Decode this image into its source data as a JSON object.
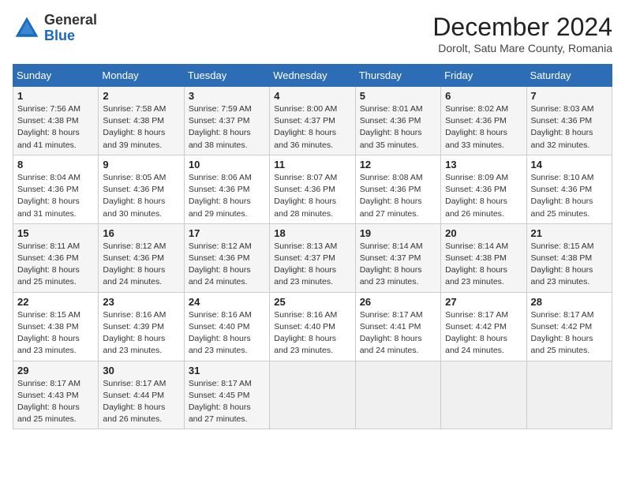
{
  "header": {
    "logo_general": "General",
    "logo_blue": "Blue",
    "month_title": "December 2024",
    "subtitle": "Dorolt, Satu Mare County, Romania"
  },
  "weekdays": [
    "Sunday",
    "Monday",
    "Tuesday",
    "Wednesday",
    "Thursday",
    "Friday",
    "Saturday"
  ],
  "weeks": [
    [
      {
        "day": "1",
        "sunrise": "Sunrise: 7:56 AM",
        "sunset": "Sunset: 4:38 PM",
        "daylight": "Daylight: 8 hours and 41 minutes."
      },
      {
        "day": "2",
        "sunrise": "Sunrise: 7:58 AM",
        "sunset": "Sunset: 4:38 PM",
        "daylight": "Daylight: 8 hours and 39 minutes."
      },
      {
        "day": "3",
        "sunrise": "Sunrise: 7:59 AM",
        "sunset": "Sunset: 4:37 PM",
        "daylight": "Daylight: 8 hours and 38 minutes."
      },
      {
        "day": "4",
        "sunrise": "Sunrise: 8:00 AM",
        "sunset": "Sunset: 4:37 PM",
        "daylight": "Daylight: 8 hours and 36 minutes."
      },
      {
        "day": "5",
        "sunrise": "Sunrise: 8:01 AM",
        "sunset": "Sunset: 4:36 PM",
        "daylight": "Daylight: 8 hours and 35 minutes."
      },
      {
        "day": "6",
        "sunrise": "Sunrise: 8:02 AM",
        "sunset": "Sunset: 4:36 PM",
        "daylight": "Daylight: 8 hours and 33 minutes."
      },
      {
        "day": "7",
        "sunrise": "Sunrise: 8:03 AM",
        "sunset": "Sunset: 4:36 PM",
        "daylight": "Daylight: 8 hours and 32 minutes."
      }
    ],
    [
      {
        "day": "8",
        "sunrise": "Sunrise: 8:04 AM",
        "sunset": "Sunset: 4:36 PM",
        "daylight": "Daylight: 8 hours and 31 minutes."
      },
      {
        "day": "9",
        "sunrise": "Sunrise: 8:05 AM",
        "sunset": "Sunset: 4:36 PM",
        "daylight": "Daylight: 8 hours and 30 minutes."
      },
      {
        "day": "10",
        "sunrise": "Sunrise: 8:06 AM",
        "sunset": "Sunset: 4:36 PM",
        "daylight": "Daylight: 8 hours and 29 minutes."
      },
      {
        "day": "11",
        "sunrise": "Sunrise: 8:07 AM",
        "sunset": "Sunset: 4:36 PM",
        "daylight": "Daylight: 8 hours and 28 minutes."
      },
      {
        "day": "12",
        "sunrise": "Sunrise: 8:08 AM",
        "sunset": "Sunset: 4:36 PM",
        "daylight": "Daylight: 8 hours and 27 minutes."
      },
      {
        "day": "13",
        "sunrise": "Sunrise: 8:09 AM",
        "sunset": "Sunset: 4:36 PM",
        "daylight": "Daylight: 8 hours and 26 minutes."
      },
      {
        "day": "14",
        "sunrise": "Sunrise: 8:10 AM",
        "sunset": "Sunset: 4:36 PM",
        "daylight": "Daylight: 8 hours and 25 minutes."
      }
    ],
    [
      {
        "day": "15",
        "sunrise": "Sunrise: 8:11 AM",
        "sunset": "Sunset: 4:36 PM",
        "daylight": "Daylight: 8 hours and 25 minutes."
      },
      {
        "day": "16",
        "sunrise": "Sunrise: 8:12 AM",
        "sunset": "Sunset: 4:36 PM",
        "daylight": "Daylight: 8 hours and 24 minutes."
      },
      {
        "day": "17",
        "sunrise": "Sunrise: 8:12 AM",
        "sunset": "Sunset: 4:36 PM",
        "daylight": "Daylight: 8 hours and 24 minutes."
      },
      {
        "day": "18",
        "sunrise": "Sunrise: 8:13 AM",
        "sunset": "Sunset: 4:37 PM",
        "daylight": "Daylight: 8 hours and 23 minutes."
      },
      {
        "day": "19",
        "sunrise": "Sunrise: 8:14 AM",
        "sunset": "Sunset: 4:37 PM",
        "daylight": "Daylight: 8 hours and 23 minutes."
      },
      {
        "day": "20",
        "sunrise": "Sunrise: 8:14 AM",
        "sunset": "Sunset: 4:38 PM",
        "daylight": "Daylight: 8 hours and 23 minutes."
      },
      {
        "day": "21",
        "sunrise": "Sunrise: 8:15 AM",
        "sunset": "Sunset: 4:38 PM",
        "daylight": "Daylight: 8 hours and 23 minutes."
      }
    ],
    [
      {
        "day": "22",
        "sunrise": "Sunrise: 8:15 AM",
        "sunset": "Sunset: 4:38 PM",
        "daylight": "Daylight: 8 hours and 23 minutes."
      },
      {
        "day": "23",
        "sunrise": "Sunrise: 8:16 AM",
        "sunset": "Sunset: 4:39 PM",
        "daylight": "Daylight: 8 hours and 23 minutes."
      },
      {
        "day": "24",
        "sunrise": "Sunrise: 8:16 AM",
        "sunset": "Sunset: 4:40 PM",
        "daylight": "Daylight: 8 hours and 23 minutes."
      },
      {
        "day": "25",
        "sunrise": "Sunrise: 8:16 AM",
        "sunset": "Sunset: 4:40 PM",
        "daylight": "Daylight: 8 hours and 23 minutes."
      },
      {
        "day": "26",
        "sunrise": "Sunrise: 8:17 AM",
        "sunset": "Sunset: 4:41 PM",
        "daylight": "Daylight: 8 hours and 24 minutes."
      },
      {
        "day": "27",
        "sunrise": "Sunrise: 8:17 AM",
        "sunset": "Sunset: 4:42 PM",
        "daylight": "Daylight: 8 hours and 24 minutes."
      },
      {
        "day": "28",
        "sunrise": "Sunrise: 8:17 AM",
        "sunset": "Sunset: 4:42 PM",
        "daylight": "Daylight: 8 hours and 25 minutes."
      }
    ],
    [
      {
        "day": "29",
        "sunrise": "Sunrise: 8:17 AM",
        "sunset": "Sunset: 4:43 PM",
        "daylight": "Daylight: 8 hours and 25 minutes."
      },
      {
        "day": "30",
        "sunrise": "Sunrise: 8:17 AM",
        "sunset": "Sunset: 4:44 PM",
        "daylight": "Daylight: 8 hours and 26 minutes."
      },
      {
        "day": "31",
        "sunrise": "Sunrise: 8:17 AM",
        "sunset": "Sunset: 4:45 PM",
        "daylight": "Daylight: 8 hours and 27 minutes."
      },
      null,
      null,
      null,
      null
    ]
  ]
}
